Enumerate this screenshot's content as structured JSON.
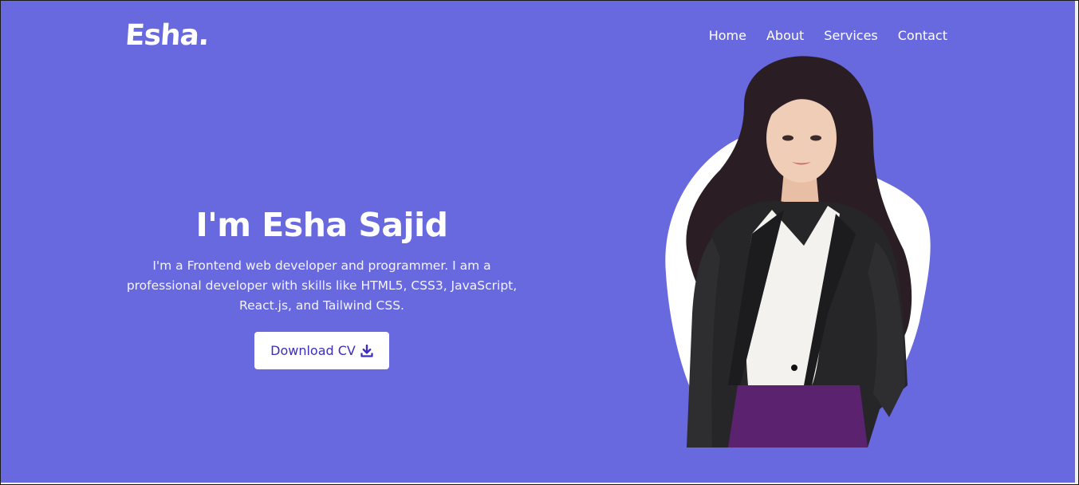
{
  "brand": {
    "logo": "Esha."
  },
  "nav": {
    "items": [
      {
        "label": "Home"
      },
      {
        "label": "About"
      },
      {
        "label": "Services"
      },
      {
        "label": "Contact"
      }
    ]
  },
  "hero": {
    "title": "I'm Esha Sajid",
    "description": "I'm a Frontend web developer and programmer. I am a professional developer with skills like HTML5, CSS3, JavaScript, React.js, and Tailwind CSS.",
    "cta_label": "Download CV",
    "cta_icon": "download-icon"
  },
  "colors": {
    "background": "#6868df",
    "text": "#ffffff",
    "button_text": "#3b2dbf",
    "button_bg": "#ffffff"
  }
}
